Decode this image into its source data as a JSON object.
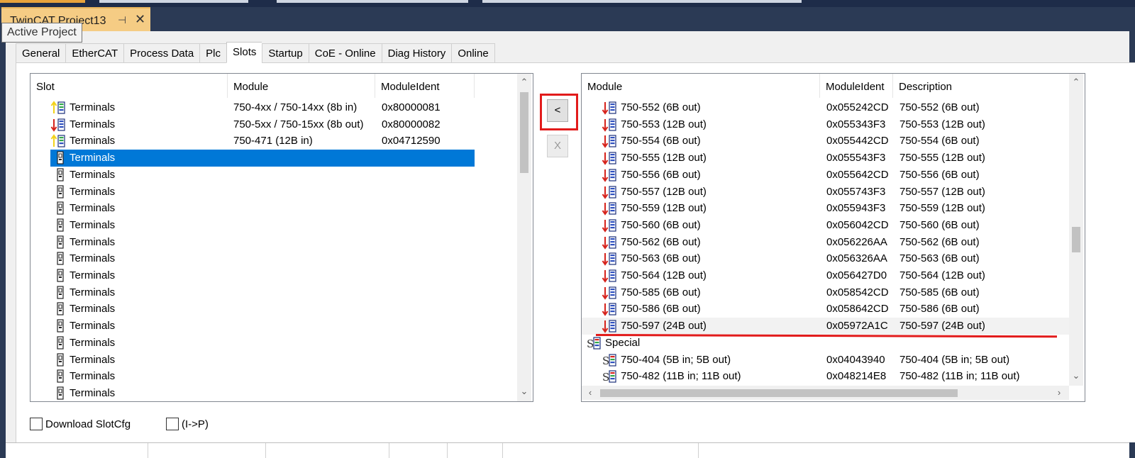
{
  "document": {
    "tab_title": "TwinCAT Project13",
    "pin_glyph": "⊣",
    "close_glyph": "✕",
    "tooltip": "Active Project"
  },
  "tabs": [
    {
      "label": "General"
    },
    {
      "label": "EtherCAT"
    },
    {
      "label": "Process Data"
    },
    {
      "label": "Plc"
    },
    {
      "label": "Slots",
      "active": true
    },
    {
      "label": "Startup"
    },
    {
      "label": "CoE - Online"
    },
    {
      "label": "Diag History"
    },
    {
      "label": "Online"
    }
  ],
  "left_list": {
    "columns": [
      "Slot",
      "Module",
      "ModuleIdent"
    ],
    "rows": [
      {
        "slot": "Terminals",
        "module": "750-4xx / 750-14xx (8b in)",
        "ident": "0x80000081",
        "icon": "input-terminal-icon"
      },
      {
        "slot": "Terminals",
        "module": "750-5xx / 750-15xx (8b out)",
        "ident": "0x80000082",
        "icon": "output-terminal-icon"
      },
      {
        "slot": "Terminals",
        "module": "750-471 (12B in)",
        "ident": "0x04712590",
        "icon": "input-terminal-icon"
      },
      {
        "slot": "Terminals",
        "module": "",
        "ident": "",
        "icon": "empty-terminal-icon",
        "selected": true
      },
      {
        "slot": "Terminals",
        "module": "",
        "ident": "",
        "icon": "empty-terminal-icon"
      },
      {
        "slot": "Terminals",
        "module": "",
        "ident": "",
        "icon": "empty-terminal-icon"
      },
      {
        "slot": "Terminals",
        "module": "",
        "ident": "",
        "icon": "empty-terminal-icon"
      },
      {
        "slot": "Terminals",
        "module": "",
        "ident": "",
        "icon": "empty-terminal-icon"
      },
      {
        "slot": "Terminals",
        "module": "",
        "ident": "",
        "icon": "empty-terminal-icon"
      },
      {
        "slot": "Terminals",
        "module": "",
        "ident": "",
        "icon": "empty-terminal-icon"
      },
      {
        "slot": "Terminals",
        "module": "",
        "ident": "",
        "icon": "empty-terminal-icon"
      },
      {
        "slot": "Terminals",
        "module": "",
        "ident": "",
        "icon": "empty-terminal-icon"
      },
      {
        "slot": "Terminals",
        "module": "",
        "ident": "",
        "icon": "empty-terminal-icon"
      },
      {
        "slot": "Terminals",
        "module": "",
        "ident": "",
        "icon": "empty-terminal-icon"
      },
      {
        "slot": "Terminals",
        "module": "",
        "ident": "",
        "icon": "empty-terminal-icon"
      },
      {
        "slot": "Terminals",
        "module": "",
        "ident": "",
        "icon": "empty-terminal-icon"
      },
      {
        "slot": "Terminals",
        "module": "",
        "ident": "",
        "icon": "empty-terminal-icon"
      },
      {
        "slot": "Terminals",
        "module": "",
        "ident": "",
        "icon": "empty-terminal-icon"
      }
    ]
  },
  "buttons": {
    "insert_label": "<",
    "remove_label": "X"
  },
  "right_list": {
    "columns": [
      "Module",
      "ModuleIdent",
      "Description"
    ],
    "rows": [
      {
        "module": "750-552 (6B out)",
        "ident": "0x055242CD",
        "desc": "750-552 (6B out)",
        "icon": "output-terminal-icon"
      },
      {
        "module": "750-553 (12B out)",
        "ident": "0x055343F3",
        "desc": "750-553 (12B out)",
        "icon": "output-terminal-icon"
      },
      {
        "module": "750-554 (6B out)",
        "ident": "0x055442CD",
        "desc": "750-554 (6B out)",
        "icon": "output-terminal-icon"
      },
      {
        "module": "750-555 (12B out)",
        "ident": "0x055543F3",
        "desc": "750-555 (12B out)",
        "icon": "output-terminal-icon"
      },
      {
        "module": "750-556 (6B out)",
        "ident": "0x055642CD",
        "desc": "750-556 (6B out)",
        "icon": "output-terminal-icon"
      },
      {
        "module": "750-557 (12B out)",
        "ident": "0x055743F3",
        "desc": "750-557 (12B out)",
        "icon": "output-terminal-icon"
      },
      {
        "module": "750-559 (12B out)",
        "ident": "0x055943F3",
        "desc": "750-559 (12B out)",
        "icon": "output-terminal-icon"
      },
      {
        "module": "750-560 (6B out)",
        "ident": "0x056042CD",
        "desc": "750-560 (6B out)",
        "icon": "output-terminal-icon"
      },
      {
        "module": "750-562 (6B out)",
        "ident": "0x056226AA",
        "desc": "750-562 (6B out)",
        "icon": "output-terminal-icon"
      },
      {
        "module": "750-563 (6B out)",
        "ident": "0x056326AA",
        "desc": "750-563 (6B out)",
        "icon": "output-terminal-icon"
      },
      {
        "module": "750-564 (12B out)",
        "ident": "0x056427D0",
        "desc": "750-564 (12B out)",
        "icon": "output-terminal-icon"
      },
      {
        "module": "750-585 (6B out)",
        "ident": "0x058542CD",
        "desc": "750-585 (6B out)",
        "icon": "output-terminal-icon"
      },
      {
        "module": "750-586 (6B out)",
        "ident": "0x058642CD",
        "desc": "750-586 (6B out)",
        "icon": "output-terminal-icon"
      },
      {
        "module": "750-597 (24B out)",
        "ident": "0x05972A1C",
        "desc": "750-597 (24B out)",
        "icon": "output-terminal-icon",
        "hover": true
      },
      {
        "module": "Special",
        "ident": "",
        "desc": "",
        "icon": "special-group-icon",
        "group": true
      },
      {
        "module": "750-404 (5B in; 5B out)",
        "ident": "0x04043940",
        "desc": "750-404 (5B in; 5B out)",
        "icon": "special-terminal-icon"
      },
      {
        "module": "750-482 (11B in; 11B out)",
        "ident": "0x048214E8",
        "desc": "750-482 (11B in; 11B out)",
        "icon": "special-terminal-icon"
      }
    ]
  },
  "checkboxes": {
    "download_slotcfg": "Download SlotCfg",
    "i_to_p": "(I->P)"
  },
  "colors": {
    "selection": "#0078d7",
    "annotation_red": "#e21b1b",
    "ide_dark": "#2b3a55",
    "doc_tab": "#f5cc84"
  }
}
